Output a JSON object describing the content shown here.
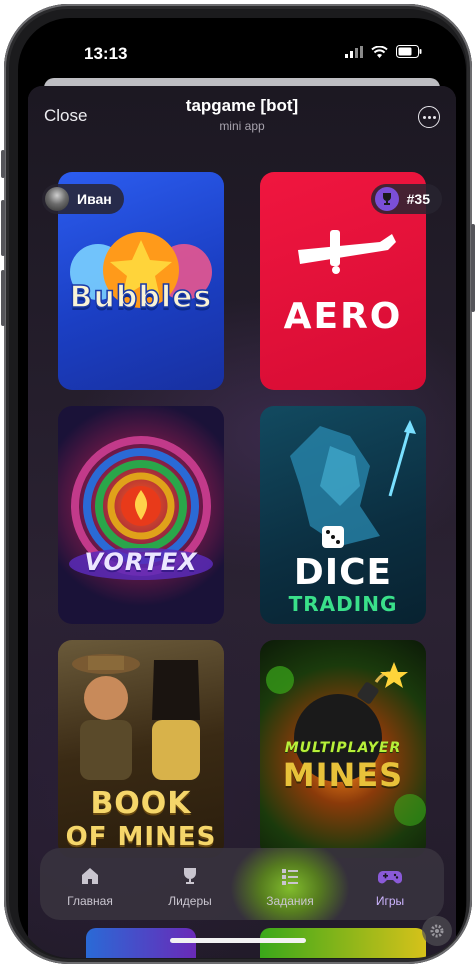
{
  "status": {
    "time": "13:13"
  },
  "header": {
    "close_label": "Close",
    "title": "tapgame [bot]",
    "subtitle": "mini app"
  },
  "user": {
    "name": "Иван",
    "rank": "#35"
  },
  "games": [
    {
      "name": "Bubbles",
      "label": "Bubbles",
      "bg": "#1c4fd6"
    },
    {
      "name": "Aero",
      "label": "AERO",
      "bg": "#e0123a"
    },
    {
      "name": "Vortex",
      "label": "VORTEX",
      "bg": "#1a1430"
    },
    {
      "name": "Dice Trading",
      "label_top": "DICE",
      "label_bottom": "TRADING",
      "bg": "#0d3a4a"
    },
    {
      "name": "Book of Mines",
      "label_top": "BOOK",
      "label_bottom": "OF MINES",
      "bg": "#3a2a12"
    },
    {
      "name": "Multiplayer Mines",
      "label_top": "MULTIPLAYER",
      "label_bottom": "MINES",
      "bg": "#0f2a0f"
    }
  ],
  "nav": [
    {
      "label": "Главная",
      "icon": "home-icon"
    },
    {
      "label": "Лидеры",
      "icon": "trophy-icon"
    },
    {
      "label": "Задания",
      "icon": "list-icon"
    },
    {
      "label": "Игры",
      "icon": "gamepad-icon",
      "active": true
    }
  ],
  "colors": {
    "accent": "#7b4fd6",
    "aero": "#e0123a",
    "bubbles": "#1c4fd6"
  }
}
